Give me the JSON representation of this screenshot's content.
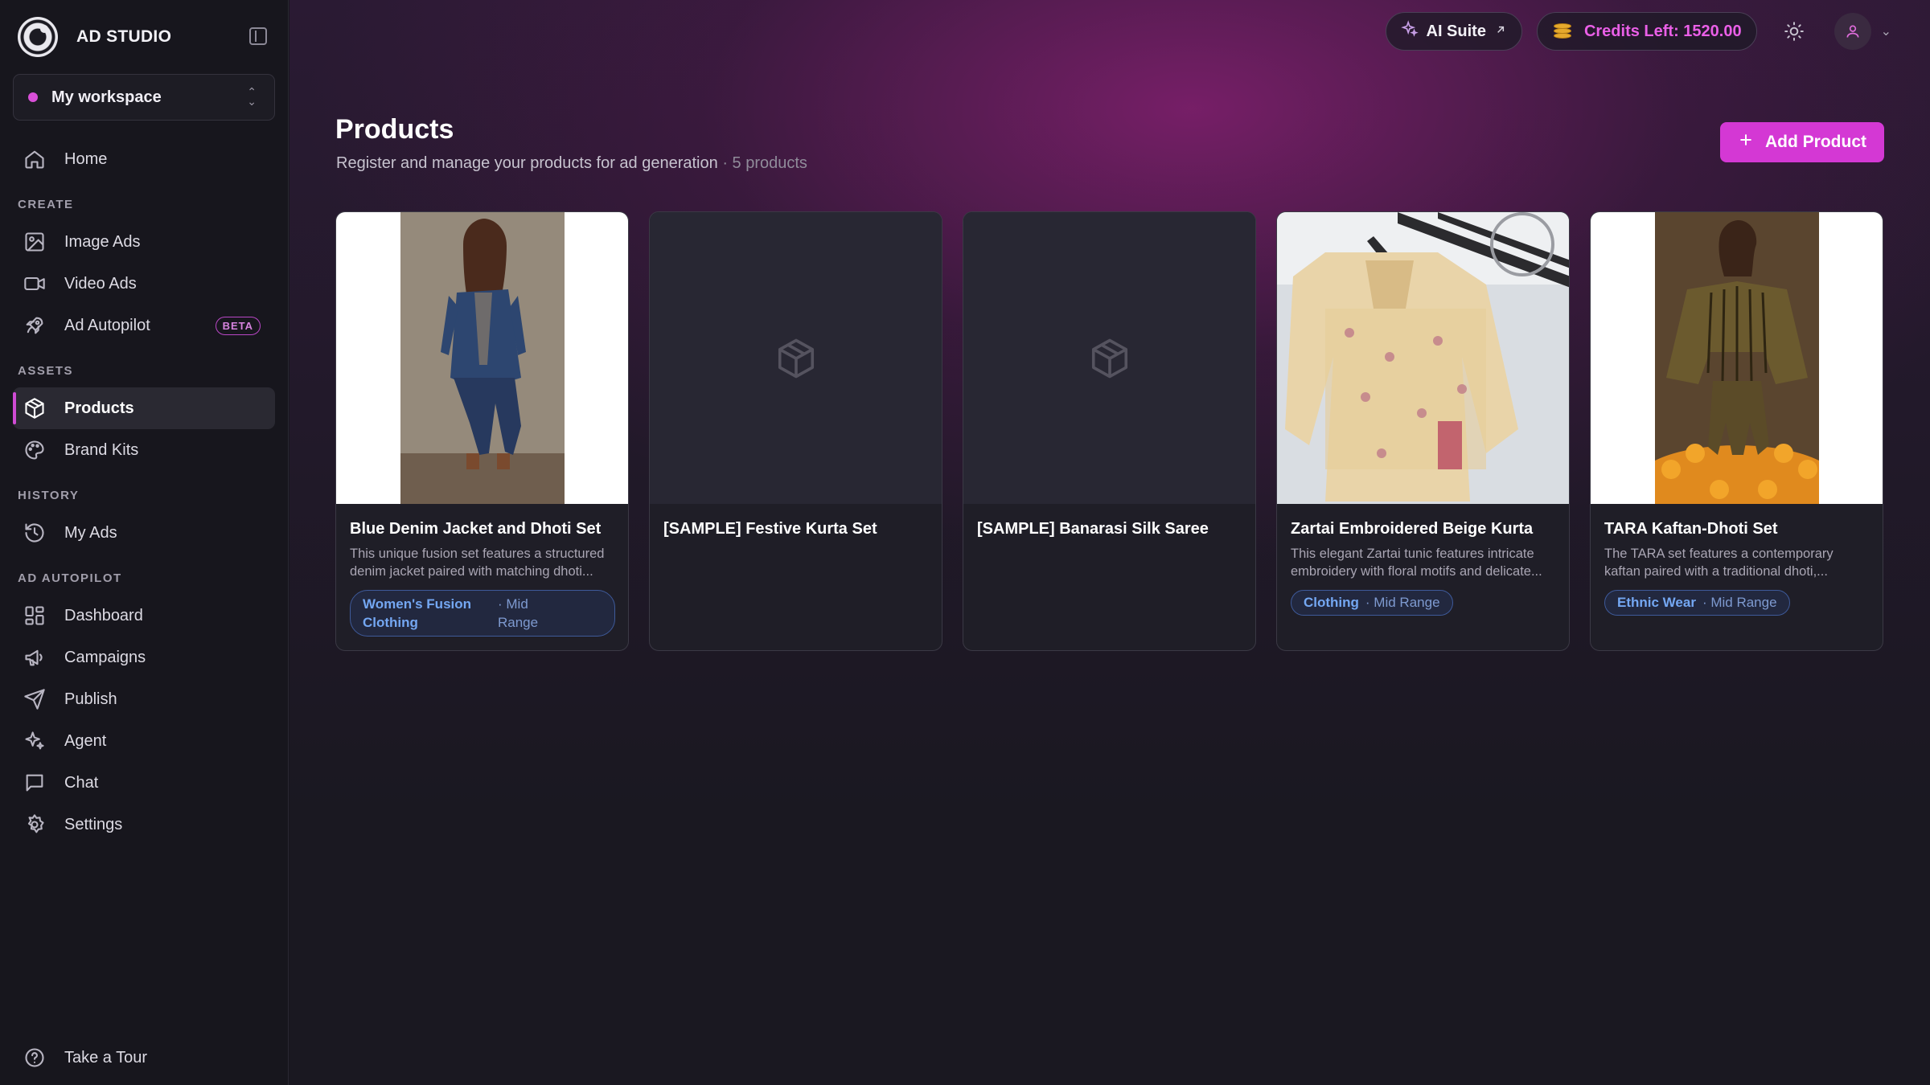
{
  "app": {
    "name": "AD STUDIO"
  },
  "workspace": {
    "name": "My workspace"
  },
  "nav": {
    "home": "Home",
    "sections": {
      "create": "CREATE",
      "assets": "ASSETS",
      "history": "HISTORY",
      "autopilot": "AD AUTOPILOT"
    },
    "image_ads": "Image Ads",
    "video_ads": "Video Ads",
    "ad_autopilot": "Ad Autopilot",
    "beta": "BETA",
    "products": "Products",
    "brand_kits": "Brand Kits",
    "my_ads": "My Ads",
    "dashboard": "Dashboard",
    "campaigns": "Campaigns",
    "publish": "Publish",
    "agent": "Agent",
    "chat": "Chat",
    "settings": "Settings",
    "tour": "Take a Tour"
  },
  "topbar": {
    "ai_suite": "AI Suite",
    "credits": "Credits Left: 1520.00"
  },
  "page": {
    "title": "Products",
    "subtitle": "Register and manage your products for ad generation",
    "count": "· 5 products",
    "add_button": "Add Product"
  },
  "products": [
    {
      "title": "Blue Denim Jacket and Dhoti Set",
      "description": "This unique fusion set features a structured denim jacket paired with matching dhoti...",
      "category": "Women's Fusion Clothing",
      "price_range": "· Mid Range"
    },
    {
      "title": "[SAMPLE] Festive Kurta Set"
    },
    {
      "title": "[SAMPLE] Banarasi Silk Saree"
    },
    {
      "title": "Zartai Embroidered Beige Kurta",
      "description": "This elegant Zartai tunic features intricate embroidery with floral motifs and delicate...",
      "category": "Clothing",
      "price_range": "· Mid Range"
    },
    {
      "title": "TARA Kaftan-Dhoti Set",
      "description": "The TARA set features a contemporary kaftan paired with a traditional dhoti,...",
      "category": "Ethnic Wear",
      "price_range": "· Mid Range"
    }
  ],
  "colors": {
    "accent": "#d438d4",
    "tag_text": "#74a7f2",
    "credits": "#ea5fe7"
  }
}
